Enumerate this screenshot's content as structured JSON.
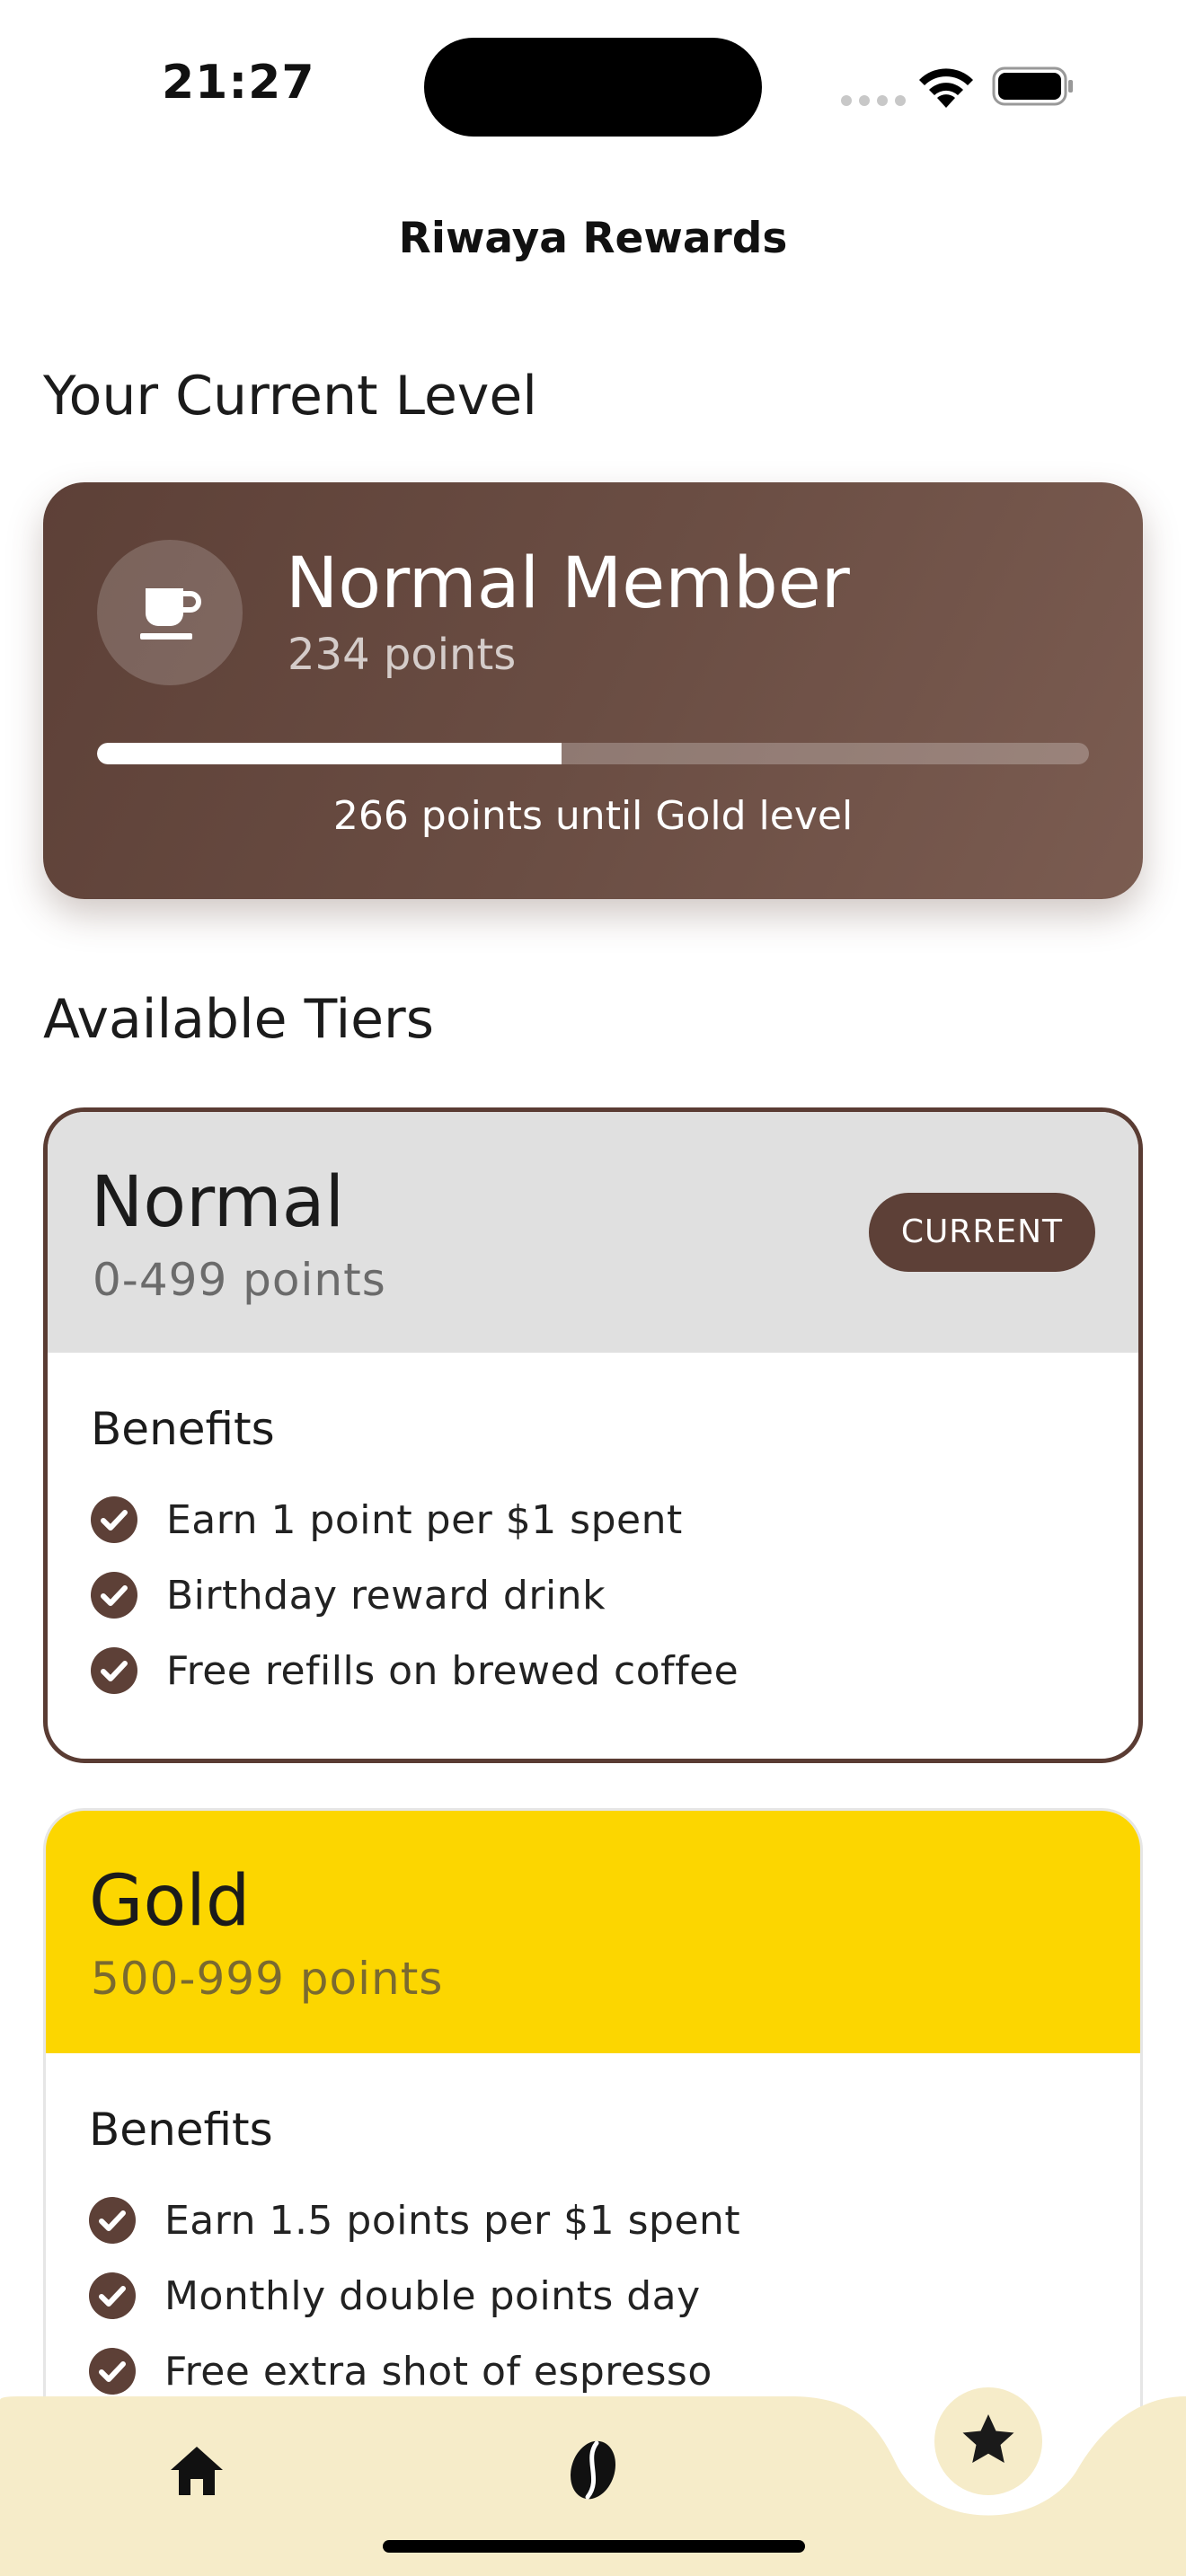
{
  "status_bar": {
    "time": "21:27"
  },
  "nav": {
    "title": "Riwaya Rewards"
  },
  "current_level": {
    "heading": "Your Current Level",
    "name": "Normal Member",
    "points": "234 points",
    "progress_fraction": 0.468,
    "progress_caption": "266 points until Gold level",
    "icon": "coffee-cup-icon"
  },
  "tiers_section": {
    "heading": "Available Tiers",
    "tiers": [
      {
        "name": "Normal",
        "range": "0-499 points",
        "badge": "CURRENT",
        "benefits_title": "Benefits",
        "benefits": [
          "Earn 1 point per $1 spent",
          "Birthday reward drink",
          "Free refills on brewed coffee"
        ]
      },
      {
        "name": "Gold",
        "range": "500-999 points",
        "benefits_title": "Benefits",
        "benefits": [
          "Earn 1.5 points per $1 spent",
          "Monthly double points day",
          "Free extra shot of espresso"
        ]
      }
    ]
  },
  "tab_bar": {
    "items": [
      {
        "icon": "home-icon",
        "active": false
      },
      {
        "icon": "coffee-bean-icon",
        "active": false
      },
      {
        "icon": "star-icon",
        "active": true
      }
    ]
  },
  "colors": {
    "brand_brown": "#5d4037",
    "gold": "#fcd600",
    "tab_bar_bg": "#f6ecc9",
    "normal_header": "#e0e0e0"
  }
}
